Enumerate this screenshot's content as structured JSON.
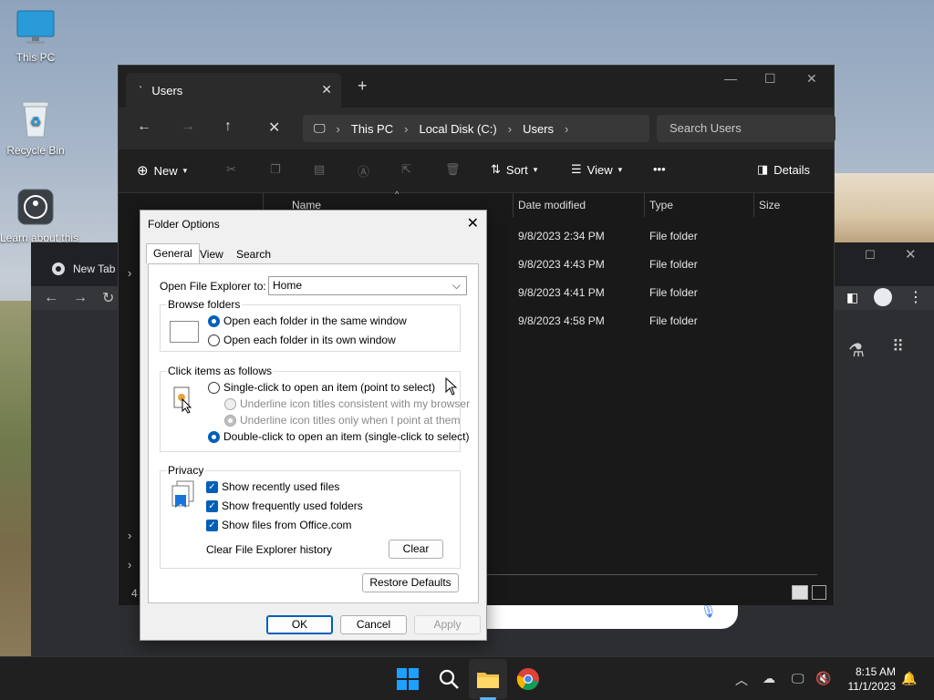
{
  "desktop": {
    "icons": [
      {
        "label": "This PC"
      },
      {
        "label": "Recycle Bin"
      },
      {
        "label": "Learn about this p"
      }
    ]
  },
  "chrome": {
    "tab_title": "New Tab"
  },
  "explorer": {
    "tab_title": "Users",
    "tab_mark": "`",
    "breadcrumb": [
      "This PC",
      "Local Disk (C:)",
      "Users"
    ],
    "search_placeholder": "Search Users",
    "toolbar": {
      "new": "New",
      "sort": "Sort",
      "view": "View",
      "details": "Details"
    },
    "columns": [
      "Name",
      "Date modified",
      "Type",
      "Size"
    ],
    "rows": [
      {
        "date": "9/8/2023 2:34 PM",
        "type": "File folder"
      },
      {
        "date": "9/8/2023 4:43 PM",
        "type": "File folder"
      },
      {
        "date": "9/8/2023 4:41 PM",
        "type": "File folder"
      },
      {
        "date": "9/8/2023 4:58 PM",
        "type": "File folder"
      }
    ],
    "item_count": "4"
  },
  "dialog": {
    "title": "Folder Options",
    "tabs": [
      "General",
      "View",
      "Search"
    ],
    "open_to_label": "Open File Explorer to:",
    "open_to_value": "Home",
    "browse": {
      "title": "Browse folders",
      "same_window": "Open each folder in the same window",
      "own_window": "Open each folder in its own window"
    },
    "click": {
      "title": "Click items as follows",
      "single": "Single-click to open an item (point to select)",
      "underline_browser": "Underline icon titles consistent with my browser",
      "underline_point": "Underline icon titles only when I point at them",
      "double": "Double-click to open an item (single-click to select)"
    },
    "privacy": {
      "title": "Privacy",
      "recent": "Show recently used files",
      "frequent": "Show frequently used folders",
      "office": "Show files from Office.com",
      "clear_history_label": "Clear File Explorer history",
      "clear_button": "Clear"
    },
    "restore_defaults": "Restore Defaults",
    "ok": "OK",
    "cancel": "Cancel",
    "apply": "Apply"
  },
  "taskbar": {
    "time": "8:15 AM",
    "date": "11/1/2023"
  },
  "colors": {
    "accent": "#005fb8",
    "explorer_bg": "#1c1c1c",
    "taskbar_bg": "#202020"
  }
}
